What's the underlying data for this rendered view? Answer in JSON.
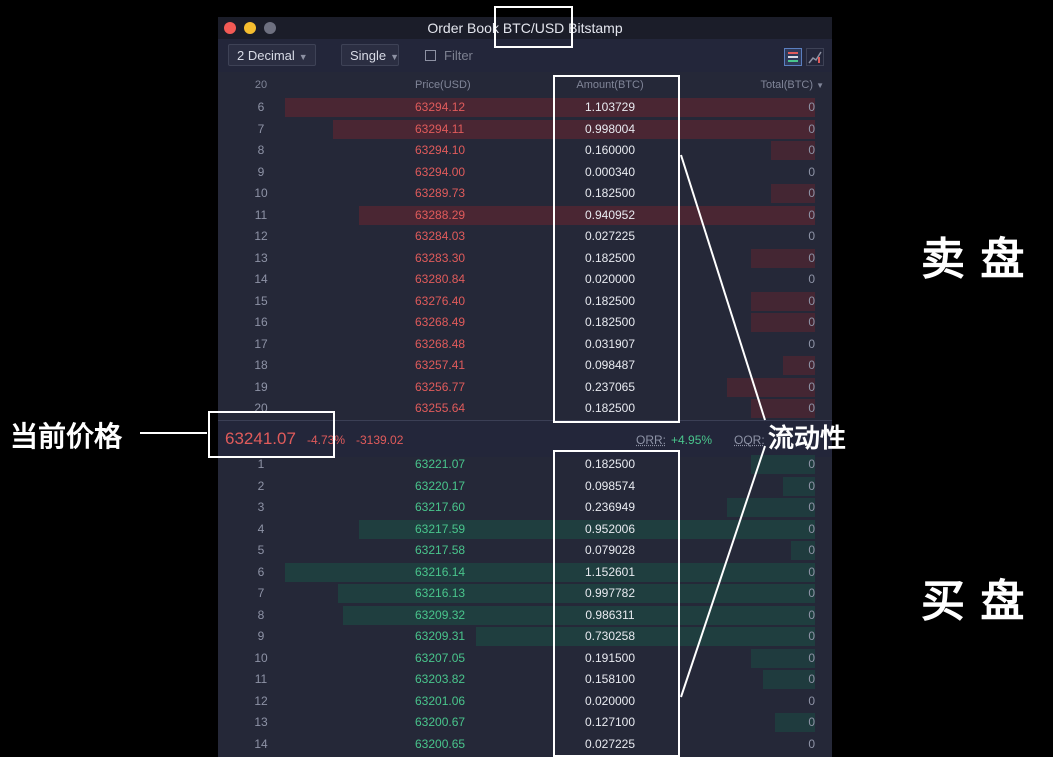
{
  "window": {
    "title": "Order Book BTC/USD Bitstamp",
    "traffic_lights": [
      "close",
      "minimize",
      "zoom"
    ]
  },
  "toolbar": {
    "decimal_select": "2 Decimal",
    "mode_select": "Single",
    "filter_label": "Filter",
    "filter_checked": false,
    "view_toggle_icons": [
      "table-view-icon",
      "depth-chart-icon"
    ]
  },
  "columns": {
    "count": "20",
    "price": "Price(USD)",
    "amount": "Amount(BTC)",
    "total": "Total(BTC)"
  },
  "asks": [
    {
      "idx": "6",
      "price": "63294.12",
      "amount": "1.103729",
      "total": "0",
      "depth": 1.0,
      "cum": 0.0
    },
    {
      "idx": "7",
      "price": "63294.11",
      "amount": "0.998004",
      "total": "0",
      "depth": 0.91,
      "cum": 0.0
    },
    {
      "idx": "8",
      "price": "63294.10",
      "amount": "0.160000",
      "total": "0",
      "depth": 0.0,
      "cum": 0.11
    },
    {
      "idx": "9",
      "price": "63294.00",
      "amount": "0.000340",
      "total": "0",
      "depth": 0.0,
      "cum": 0.0
    },
    {
      "idx": "10",
      "price": "63289.73",
      "amount": "0.182500",
      "total": "0",
      "depth": 0.0,
      "cum": 0.11
    },
    {
      "idx": "11",
      "price": "63288.29",
      "amount": "0.940952",
      "total": "0",
      "depth": 0.86,
      "cum": 0.0
    },
    {
      "idx": "12",
      "price": "63284.03",
      "amount": "0.027225",
      "total": "0",
      "depth": 0.0,
      "cum": 0.0
    },
    {
      "idx": "13",
      "price": "63283.30",
      "amount": "0.182500",
      "total": "0",
      "depth": 0.0,
      "cum": 0.16
    },
    {
      "idx": "14",
      "price": "63280.84",
      "amount": "0.020000",
      "total": "0",
      "depth": 0.0,
      "cum": 0.0
    },
    {
      "idx": "15",
      "price": "63276.40",
      "amount": "0.182500",
      "total": "0",
      "depth": 0.0,
      "cum": 0.16
    },
    {
      "idx": "16",
      "price": "63268.49",
      "amount": "0.182500",
      "total": "0",
      "depth": 0.0,
      "cum": 0.16
    },
    {
      "idx": "17",
      "price": "63268.48",
      "amount": "0.031907",
      "total": "0",
      "depth": 0.0,
      "cum": 0.0
    },
    {
      "idx": "18",
      "price": "63257.41",
      "amount": "0.098487",
      "total": "0",
      "depth": 0.0,
      "cum": 0.08
    },
    {
      "idx": "19",
      "price": "63256.77",
      "amount": "0.237065",
      "total": "0",
      "depth": 0.0,
      "cum": 0.22
    },
    {
      "idx": "20",
      "price": "63255.64",
      "amount": "0.182500",
      "total": "0",
      "depth": 0.0,
      "cum": 0.16
    }
  ],
  "ticker": {
    "last_price": "63241.07",
    "change_pct": "-4.73%",
    "change_abs": "-3139.02",
    "orr_label": "ORR:",
    "orr_value": "+4.95%",
    "oqr_label": "OQR:"
  },
  "bids": [
    {
      "idx": "1",
      "price": "63221.07",
      "amount": "0.182500",
      "total": "0",
      "depth": 0.0,
      "cum": 0.16
    },
    {
      "idx": "2",
      "price": "63220.17",
      "amount": "0.098574",
      "total": "0",
      "depth": 0.0,
      "cum": 0.08
    },
    {
      "idx": "3",
      "price": "63217.60",
      "amount": "0.236949",
      "total": "0",
      "depth": 0.0,
      "cum": 0.22
    },
    {
      "idx": "4",
      "price": "63217.59",
      "amount": "0.952006",
      "total": "0",
      "depth": 0.86,
      "cum": 0.0
    },
    {
      "idx": "5",
      "price": "63217.58",
      "amount": "0.079028",
      "total": "0",
      "depth": 0.0,
      "cum": 0.06
    },
    {
      "idx": "6",
      "price": "63216.14",
      "amount": "1.152601",
      "total": "0",
      "depth": 1.0,
      "cum": 0.0
    },
    {
      "idx": "7",
      "price": "63216.13",
      "amount": "0.997782",
      "total": "0",
      "depth": 0.9,
      "cum": 0.0
    },
    {
      "idx": "8",
      "price": "63209.32",
      "amount": "0.986311",
      "total": "0",
      "depth": 0.89,
      "cum": 0.0
    },
    {
      "idx": "9",
      "price": "63209.31",
      "amount": "0.730258",
      "total": "0",
      "depth": 0.64,
      "cum": 0.0
    },
    {
      "idx": "10",
      "price": "63207.05",
      "amount": "0.191500",
      "total": "0",
      "depth": 0.0,
      "cum": 0.16
    },
    {
      "idx": "11",
      "price": "63203.82",
      "amount": "0.158100",
      "total": "0",
      "depth": 0.0,
      "cum": 0.13
    },
    {
      "idx": "12",
      "price": "63201.06",
      "amount": "0.020000",
      "total": "0",
      "depth": 0.0,
      "cum": 0.0
    },
    {
      "idx": "13",
      "price": "63200.67",
      "amount": "0.127100",
      "total": "0",
      "depth": 0.0,
      "cum": 0.1
    },
    {
      "idx": "14",
      "price": "63200.65",
      "amount": "0.027225",
      "total": "0",
      "depth": 0.0,
      "cum": 0.0
    }
  ],
  "annotations": {
    "sell_side": "卖 盘",
    "buy_side": "买 盘",
    "current_price": "当前价格",
    "liquidity": "流动性"
  },
  "colors": {
    "ask": "#e05b5b",
    "bid": "#49c58c",
    "ask_bar": "#4a2633",
    "bid_bar": "#1f3e3f",
    "background": "#252838"
  }
}
